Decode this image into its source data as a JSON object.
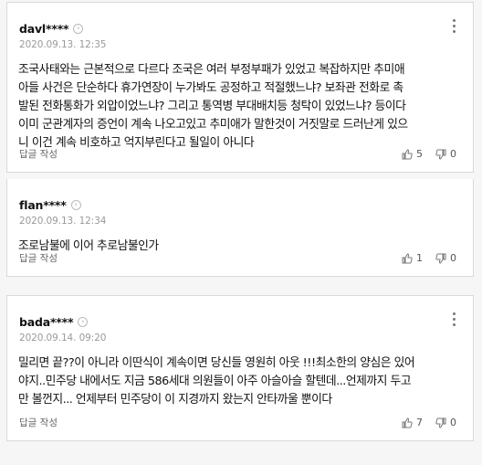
{
  "comments": [
    {
      "user": "davl****",
      "badge": "›",
      "date": "2020.09.13. 12:35",
      "text": "조국사태와는 근본적으로 다르다 조국은 여러 부정부패가 있었고 복잡하지만 추미애\n아들 사건은 단순하다 휴가연장이 누가봐도 공정하고 적절했느냐? 보좌관 전화로 촉\n발된 전화통화가 외압이었느냐? 그리고 통역병 부대배치등 청탁이 있었느냐? 등이다\n이미 군관계자의 증언이 계속 나오고있고 추미애가 말한것이 거짓말로 드러난게 있으\n니 이건 계속 비호하고 억지부린다고 될일이 아니다",
      "reply_label": "답글 작성",
      "likes": "5",
      "dislikes": "0"
    },
    {
      "user": "flan****",
      "badge": "›",
      "date": "2020.09.13. 12:34",
      "text": "조로남불에 이어 추로남불인가",
      "reply_label": "답글 작성",
      "likes": "1",
      "dislikes": "0"
    },
    {
      "user": "bada****",
      "badge": "›",
      "date": "2020.09.14. 09:20",
      "text": "밀리면 끝??이 아니라 이딴식이 계속이면 당신들 영원히 아웃 !!!최소한의 양심은 있어\n야지..민주당 내에서도 지금 586세대 의원들이 아주 아슬아슬 할텐데...언제까지 두고\n만 볼껀지... 언제부터 민주당이 이 지경까지 왔는지 안타까울 뿐이다",
      "reply_label": "답글 작성",
      "likes": "7",
      "dislikes": "0"
    }
  ]
}
